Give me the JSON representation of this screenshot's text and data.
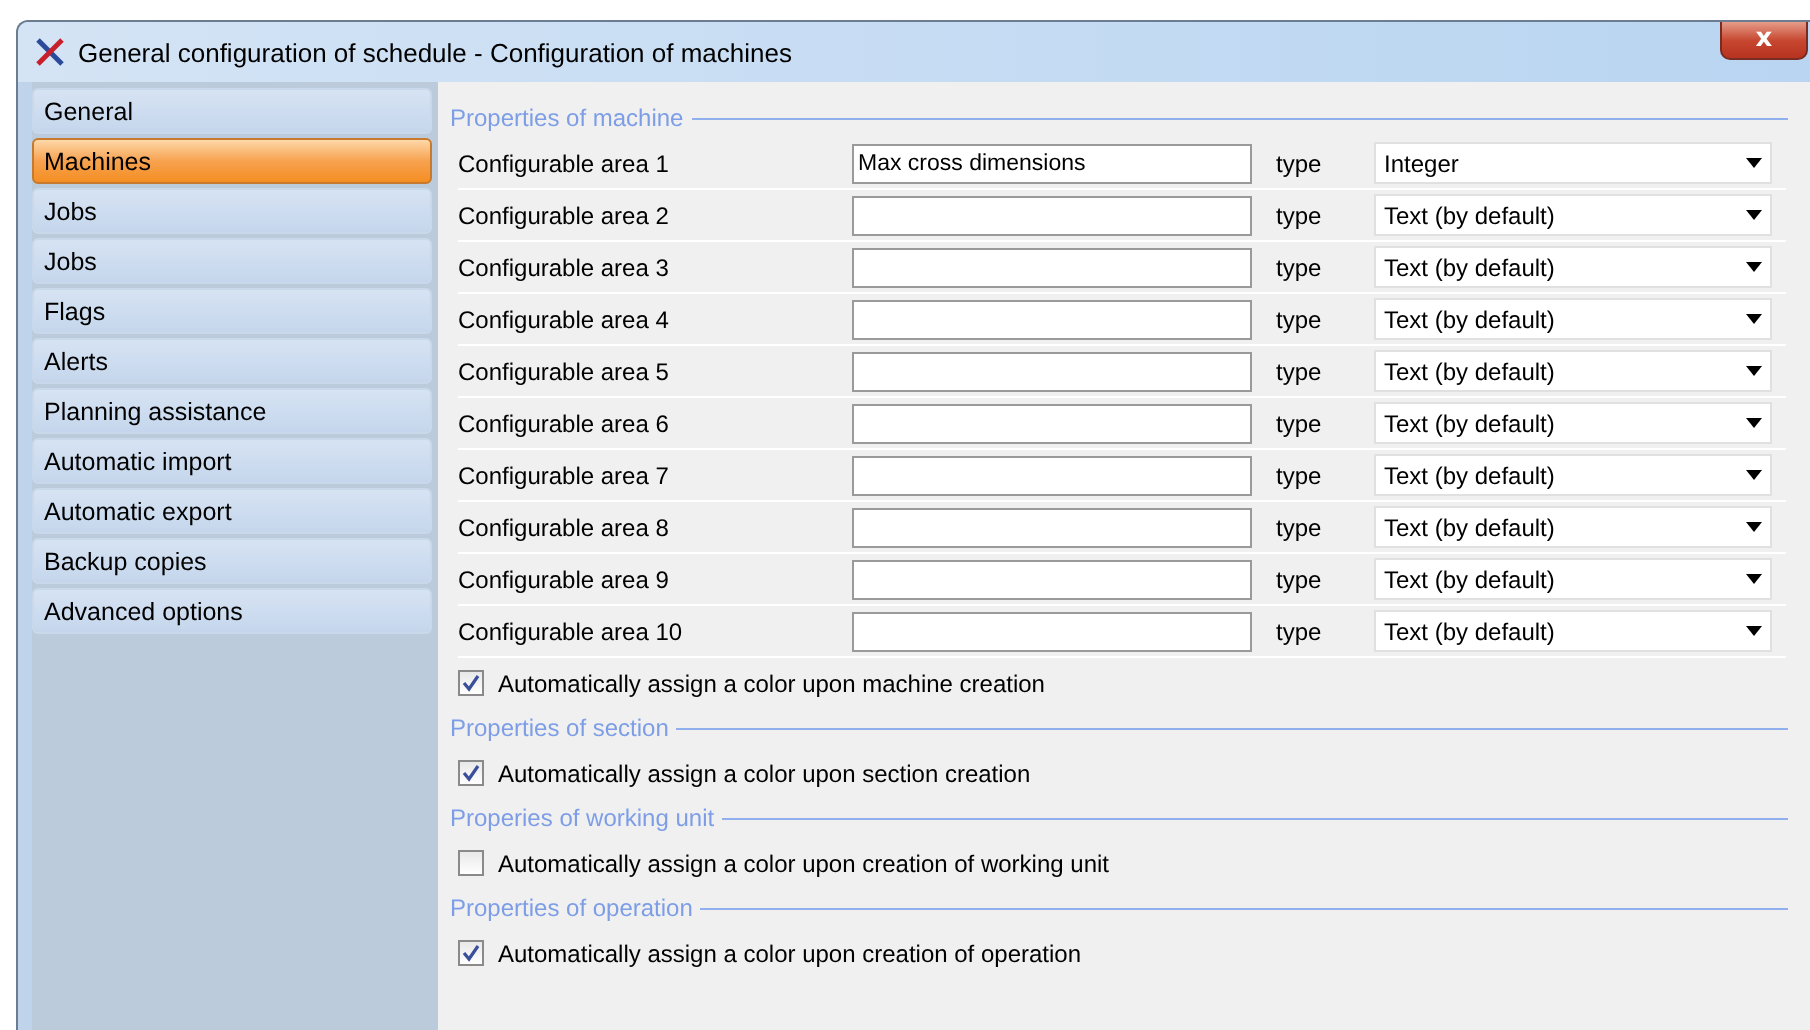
{
  "window": {
    "title": "General configuration of schedule - Configuration of machines",
    "close_label": "x"
  },
  "sidebar": {
    "items": [
      {
        "label": "General",
        "selected": false
      },
      {
        "label": "Machines",
        "selected": true
      },
      {
        "label": "Jobs",
        "selected": false
      },
      {
        "label": "Jobs",
        "selected": false
      },
      {
        "label": "Flags",
        "selected": false
      },
      {
        "label": "Alerts",
        "selected": false
      },
      {
        "label": "Planning assistance",
        "selected": false
      },
      {
        "label": "Automatic import",
        "selected": false
      },
      {
        "label": "Automatic export",
        "selected": false
      },
      {
        "label": "Backup copies",
        "selected": false
      },
      {
        "label": "Advanced options",
        "selected": false
      }
    ]
  },
  "sections": [
    {
      "title": "Properties of machine",
      "fields": [
        {
          "label": "Configurable area 1",
          "value": "Max cross dimensions",
          "type_label": "type",
          "type": "Integer"
        },
        {
          "label": "Configurable area 2",
          "type_label": "type",
          "type": "Text (by default)"
        },
        {
          "label": "Configurable area 3",
          "type_label": "type",
          "type": "Text (by default)"
        },
        {
          "label": "Configurable area 4",
          "type_label": "type",
          "type": "Text (by default)"
        },
        {
          "label": "Configurable area 5",
          "type_label": "type",
          "type": "Text (by default)"
        },
        {
          "label": "Configurable area 6",
          "type_label": "type",
          "type": "Text (by default)"
        },
        {
          "label": "Configurable area 7",
          "type_label": "type",
          "type": "Text (by default)"
        },
        {
          "label": "Configurable area 8",
          "type_label": "type",
          "type": "Text (by default)"
        },
        {
          "label": "Configurable area 9",
          "type_label": "type",
          "type": "Text (by default)"
        },
        {
          "label": "Configurable area 10",
          "type_label": "type",
          "type": "Text (by default)"
        }
      ],
      "checkbox": {
        "label": "Automatically assign a color upon machine creation",
        "checked": true
      }
    },
    {
      "title": "Properties of section",
      "checkbox": {
        "label": "Automatically assign a color upon section creation",
        "checked": true
      }
    },
    {
      "title": "Properies of working unit",
      "checkbox": {
        "label": "Automatically assign a color upon creation of working unit",
        "checked": false
      }
    },
    {
      "title": "Properties of operation",
      "checkbox": {
        "label": "Automatically assign a color upon creation of operation",
        "checked": true
      }
    }
  ]
}
